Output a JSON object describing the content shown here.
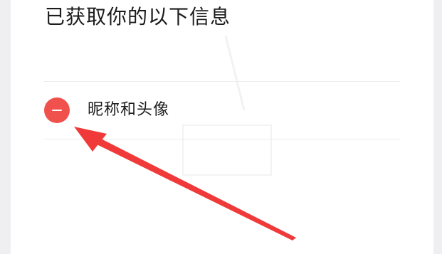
{
  "dialog": {
    "title": "已获取你的以下信息"
  },
  "permissions": [
    {
      "label": "昵称和头像",
      "remove_icon": "minus-circle-icon"
    }
  ],
  "colors": {
    "background": "#efeff2",
    "sheet": "#ffffff",
    "remove_button": "#f0514d",
    "annotation_arrow": "#f03a3a",
    "text": "#1c1c1c"
  }
}
